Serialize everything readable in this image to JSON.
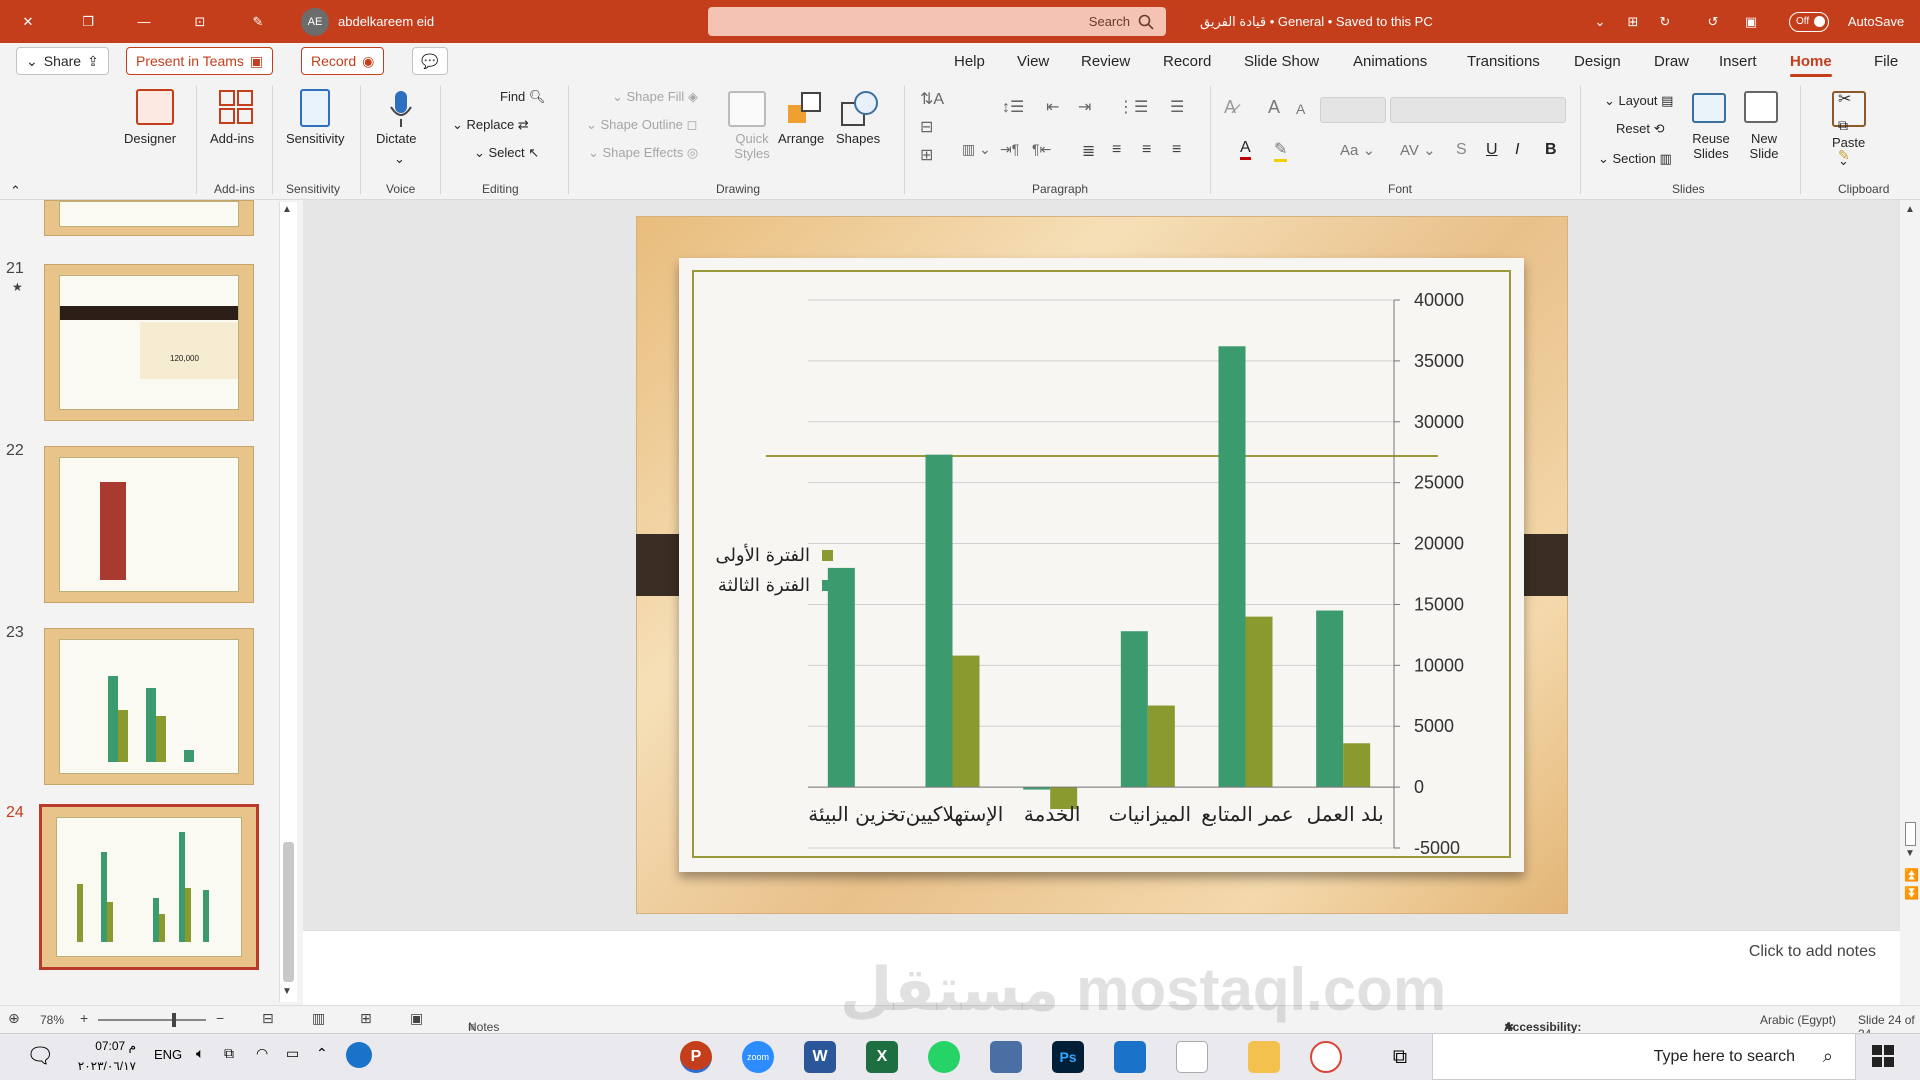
{
  "titlebar": {
    "autosave_label": "AutoSave",
    "autosave_state": "Off",
    "doc_title": "قيادة الفريق • General • Saved to this PC",
    "search_placeholder": "Search",
    "user_name": "abdelkareem eid",
    "user_initials": "AE"
  },
  "tabs": [
    "File",
    "Home",
    "Insert",
    "Draw",
    "Design",
    "Transitions",
    "Animations",
    "Slide Show",
    "Record",
    "Review",
    "View",
    "Help"
  ],
  "active_tab": "Home",
  "actions": {
    "share": "Share",
    "present_teams": "Present in Teams",
    "record": "Record"
  },
  "ribbon": {
    "clipboard": {
      "group": "Clipboard",
      "paste": "Paste"
    },
    "slides": {
      "group": "Slides",
      "new_slide": "New Slide",
      "reuse_slides": "Reuse Slides",
      "layout": "Layout",
      "reset": "Reset",
      "section": "Section"
    },
    "font": {
      "group": "Font",
      "bold": "B",
      "italic": "I",
      "underline": "U",
      "strike": "S",
      "grow": "A",
      "shrink": "A"
    },
    "paragraph": {
      "group": "Paragraph"
    },
    "drawing": {
      "group": "Drawing",
      "shapes": "Shapes",
      "arrange": "Arrange",
      "quick_styles": "Quick Styles",
      "shape_fill": "Shape Fill",
      "shape_outline": "Shape Outline",
      "shape_effects": "Shape Effects"
    },
    "editing": {
      "group": "Editing",
      "find": "Find",
      "replace": "Replace",
      "select": "Select"
    },
    "voice": {
      "group": "Voice",
      "dictate": "Dictate"
    },
    "sensitivity": {
      "group": "Sensitivity",
      "label": "Sensitivity"
    },
    "addins": {
      "group": "Add-ins",
      "label": "Add-ins"
    },
    "designer": {
      "label": "Designer"
    }
  },
  "thumbnails": [
    {
      "num": "21",
      "price": "120,000"
    },
    {
      "num": "22"
    },
    {
      "num": "23"
    },
    {
      "num": "24"
    }
  ],
  "chart_data": {
    "type": "bar",
    "categories": [
      "بلد العمل",
      "عمر المتابع",
      "الميزانيات",
      "الخدمة",
      "الإستهلاكيين",
      "تخزين البيئة"
    ],
    "series": [
      {
        "name": "الفترة الثالثة",
        "color": "#3b9a6e",
        "values": [
          14500,
          36200,
          12800,
          -200,
          27300,
          18000
        ]
      },
      {
        "name": "الفترة الأولى",
        "color": "#8b9a2e",
        "values": [
          3600,
          14000,
          6700,
          -1800,
          10800,
          0
        ]
      }
    ],
    "yticks": [
      "40000",
      "35000",
      "30000",
      "25000",
      "20000",
      "15000",
      "10000",
      "5000",
      "0",
      "-5000"
    ],
    "ylim": [
      -5000,
      40000
    ],
    "grid": true,
    "legend_position": "left"
  },
  "notes_placeholder": "Click to add notes",
  "status": {
    "slide_info": "Slide 24 of 24",
    "language": "Arabic (Egypt)",
    "accessibility": "Accessibility: Investigate",
    "notes": "Notes",
    "zoom": "78%"
  },
  "taskbar": {
    "search_placeholder": "Type here to search",
    "lang": "ENG",
    "time": "07:07 م",
    "date": "٢٠٢٣/٠٦/١٧"
  },
  "watermark": "مستقل mostaql.com"
}
